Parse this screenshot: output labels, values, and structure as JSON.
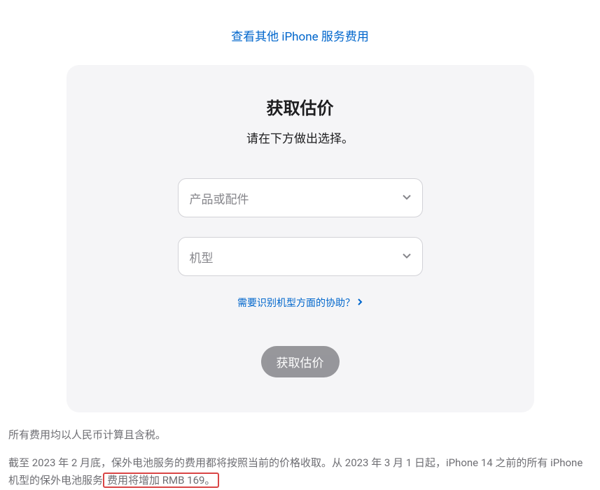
{
  "topLink": {
    "text": "查看其他 iPhone 服务费用"
  },
  "card": {
    "title": "获取估价",
    "subtitle": "请在下方做出选择。",
    "productSelect": {
      "placeholder": "产品或配件"
    },
    "modelSelect": {
      "placeholder": "机型"
    },
    "helpLink": {
      "text": "需要识别机型方面的协助？"
    },
    "submitButton": {
      "label": "获取估价"
    }
  },
  "footer": {
    "line1": "所有费用均以人民币计算且含税。",
    "line2_prefix": "截至 2023 年 2 月底，保外电池服务的费用都将按照当前的价格收取。从 2023 年 3 月 1 日起，iPhone 14 之前的所有 iPhone 机型的保外电池服务",
    "line2_highlight": "费用将增加 RMB 169。"
  }
}
